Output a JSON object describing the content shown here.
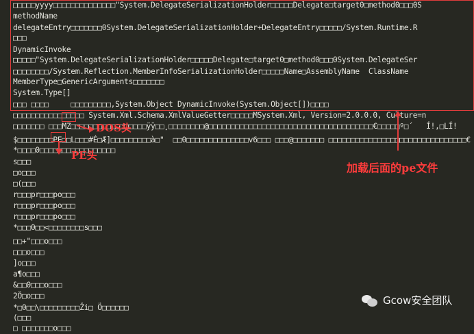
{
  "editor": {
    "lines": [
      "□□□□□yyyy□□□□□□□□□□□□□□\"System.DelegateSerializationHolder□□□□□Delegate□target0□method0□□□0S",
      "methodName",
      "delegateEntry□□□□□□□0System.DelegateSerializationHolder+DelegateEntry□□□□□/System.Runtime.R",
      "□□□",
      "DynamicInvoke",
      "□□□□□\"System.DelegateSerializationHolder□□□□□Delegate□target0□method0□□□0System.DelegateSer",
      "□□□□□□□□/System.Reflection.MemberInfoSerializationHolder□□□□□Name□AssemblyName  ClassName",
      "MemberType□GenericArguments□□□□□□□",
      "System.Type[]",
      "□□□ □□□□     □□□□□□□□□,System.Object DynamicInvoke(System.Object[])□□□□",
      "□□□□□□□□□□□□□□□□ System.Xml.Schema.XmlValueGetter□□□□□MSystem.Xml, Version=2.0.0.0, Culture=n",
      "□□□□□□□ □□□MZ□□□□□□□□□□□□□□□□□ÿÿ□□¸□□□□□□□□@□□□□□□□□□□□□□□□□□□□□□□□□□□□□□□□□□□□□□€□□□□□º□´   Í!,□LÍ!",
      "$□□□□□□□□PE□□L□□□#É□Æ]□□□□□□□□□à□\"  □□0□□□□□□□□□□□□□□v6□□□ □□□@□□□□□□□ □□□□□□□□□□□□□□□□□□□□□□□□□□□□□□□€",
      "*□□□□0□□□□□□□□□□□□□□□□□",
      "s□□□",
      "□o□□□",
      "□(□□□",
      "r□□□pr□□□po□□□",
      "r□□□pr□□□po□□□",
      "r□□□pr□□□po□□□",
      "*□□□0□□<□□□□□□□□s□□□",
      "",
      "□□+\"□□□o□□□",
      "□□□o□□□",
      "]o□□□",
      "a¶o□□□",
      "&□□0□□□o□□□",
      "2Ö□o□□□",
      "*□0□□\\□□□□□□□□□Ži□ Ö□□□□□□",
      "(□□□",
      "□ □□□□□□□o□□□"
    ]
  },
  "annotations": {
    "dos_header": "DOS头",
    "pe_header": "PE头",
    "load_pe": "加载后面的pe文件"
  },
  "watermark": {
    "icon": "wechat-icon",
    "text": "Gcow安全团队"
  },
  "colors": {
    "background": "#272822",
    "text": "#e3e3dc",
    "highlight": "#e23c3c",
    "annotation": "#ff3c3c"
  }
}
